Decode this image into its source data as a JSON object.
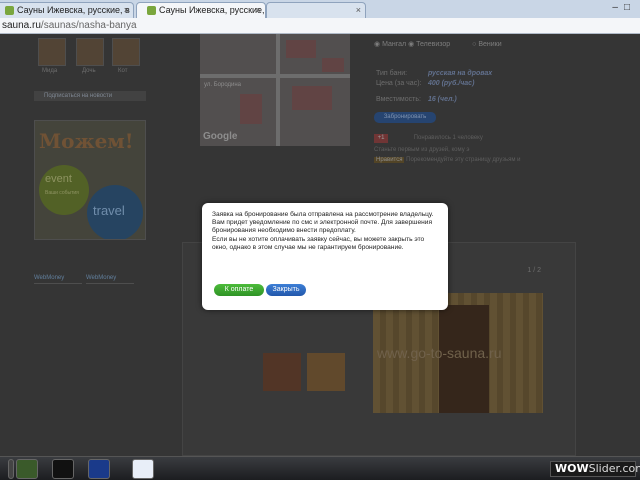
{
  "browser": {
    "tabs": [
      {
        "label": "Сауны Ижевска, русские, в"
      },
      {
        "label": "Сауны Ижевска, русские, б"
      },
      {
        "label": ""
      }
    ],
    "address_domain": "sauna.ru",
    "address_path": "/saunas/nasha-banya"
  },
  "left_column": {
    "thumbs": [
      "Мида",
      "Дочь",
      "Кот"
    ],
    "subscribe_label": "Подписаться на новости",
    "ad_logo": "Можем!",
    "ad_bubble1": "event",
    "ad_bubble1_sub": "Ваши события",
    "ad_bubble2": "travel",
    "webmoney": [
      "WebMoney",
      "WebMoney"
    ]
  },
  "map": {
    "street_label": "ул. Бородина",
    "provider": "Google"
  },
  "info": {
    "radio_options": [
      "Мангал",
      "Телевизор",
      "Веники"
    ],
    "rows": [
      {
        "label": "Тип бани:",
        "value": "русская на дровах"
      },
      {
        "label": "Цена (за час):",
        "value": "400 (руб./час)"
      },
      {
        "label": "Вместимость:",
        "value": "16 (чел.)"
      }
    ],
    "book_label": "Забронировать",
    "gplus": "+1",
    "like_count": "Понравилось 1 человеку",
    "share_text": "Станьте первым из друзей, кому э",
    "like_label": "Нравится",
    "recommend_text": "Порекомендуйте эту страницу друзьям и"
  },
  "gallery": {
    "counter": "1 / 2",
    "watermark": "www.go-to-sauna.ru"
  },
  "modal": {
    "paragraph1": "Заявка на бронирование была отправлена на рассмотрение владельцу. Вам придет уведомление по смс и электронной почте. Для завершения бронирования необходимо внести предоплату.",
    "paragraph2": "Если вы не хотите оплачивать заявку сейчас, вы можете закрыть это окно, однако в этом случае мы не гарантируем бронирование.",
    "pay_label": "К оплате",
    "close_label": "Закрыть"
  },
  "taskbar": {
    "watermark_pre": "WOW",
    "watermark_post": "Slider.com"
  }
}
